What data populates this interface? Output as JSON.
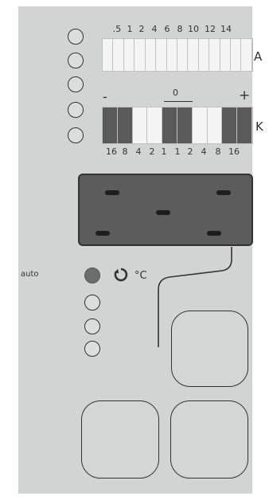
{
  "a_scale": {
    "ticks": [
      ".5",
      "1",
      "2",
      "4",
      "6",
      "8",
      "10",
      "12",
      "14"
    ],
    "unit": "A",
    "segments": [
      "#f4f4f4",
      "#f4f4f4",
      "#f4f4f4",
      "#f4f4f4",
      "#f4f4f4",
      "#f4f4f4",
      "#f4f4f4",
      "#f4f4f4",
      "#f4f4f4",
      "#f4f4f4",
      "#f4f4f4",
      "#f4f4f4",
      "#f4f4f4",
      "#f4f4f4"
    ]
  },
  "k_scale": {
    "minus": "-",
    "zero": "0",
    "plus": "+",
    "unit": "K",
    "ticks": [
      "16",
      "8",
      "4",
      "2",
      "1",
      "1",
      "2",
      "4",
      "8",
      "16"
    ],
    "segments": [
      "#5a5a5a",
      "#5a5a5a",
      "#f4f4f4",
      "#f4f4f4",
      "#5a5a5a",
      "#5a5a5a",
      "#f4f4f4",
      "#f4f4f4",
      "#5a5a5a",
      "#5a5a5a"
    ]
  },
  "mode": {
    "auto_label": "auto",
    "temp_unit": "°C"
  },
  "colors": {
    "panel": "#d2d4d4",
    "display": "#5c5c5c",
    "led_active": "#6c6c6c"
  }
}
